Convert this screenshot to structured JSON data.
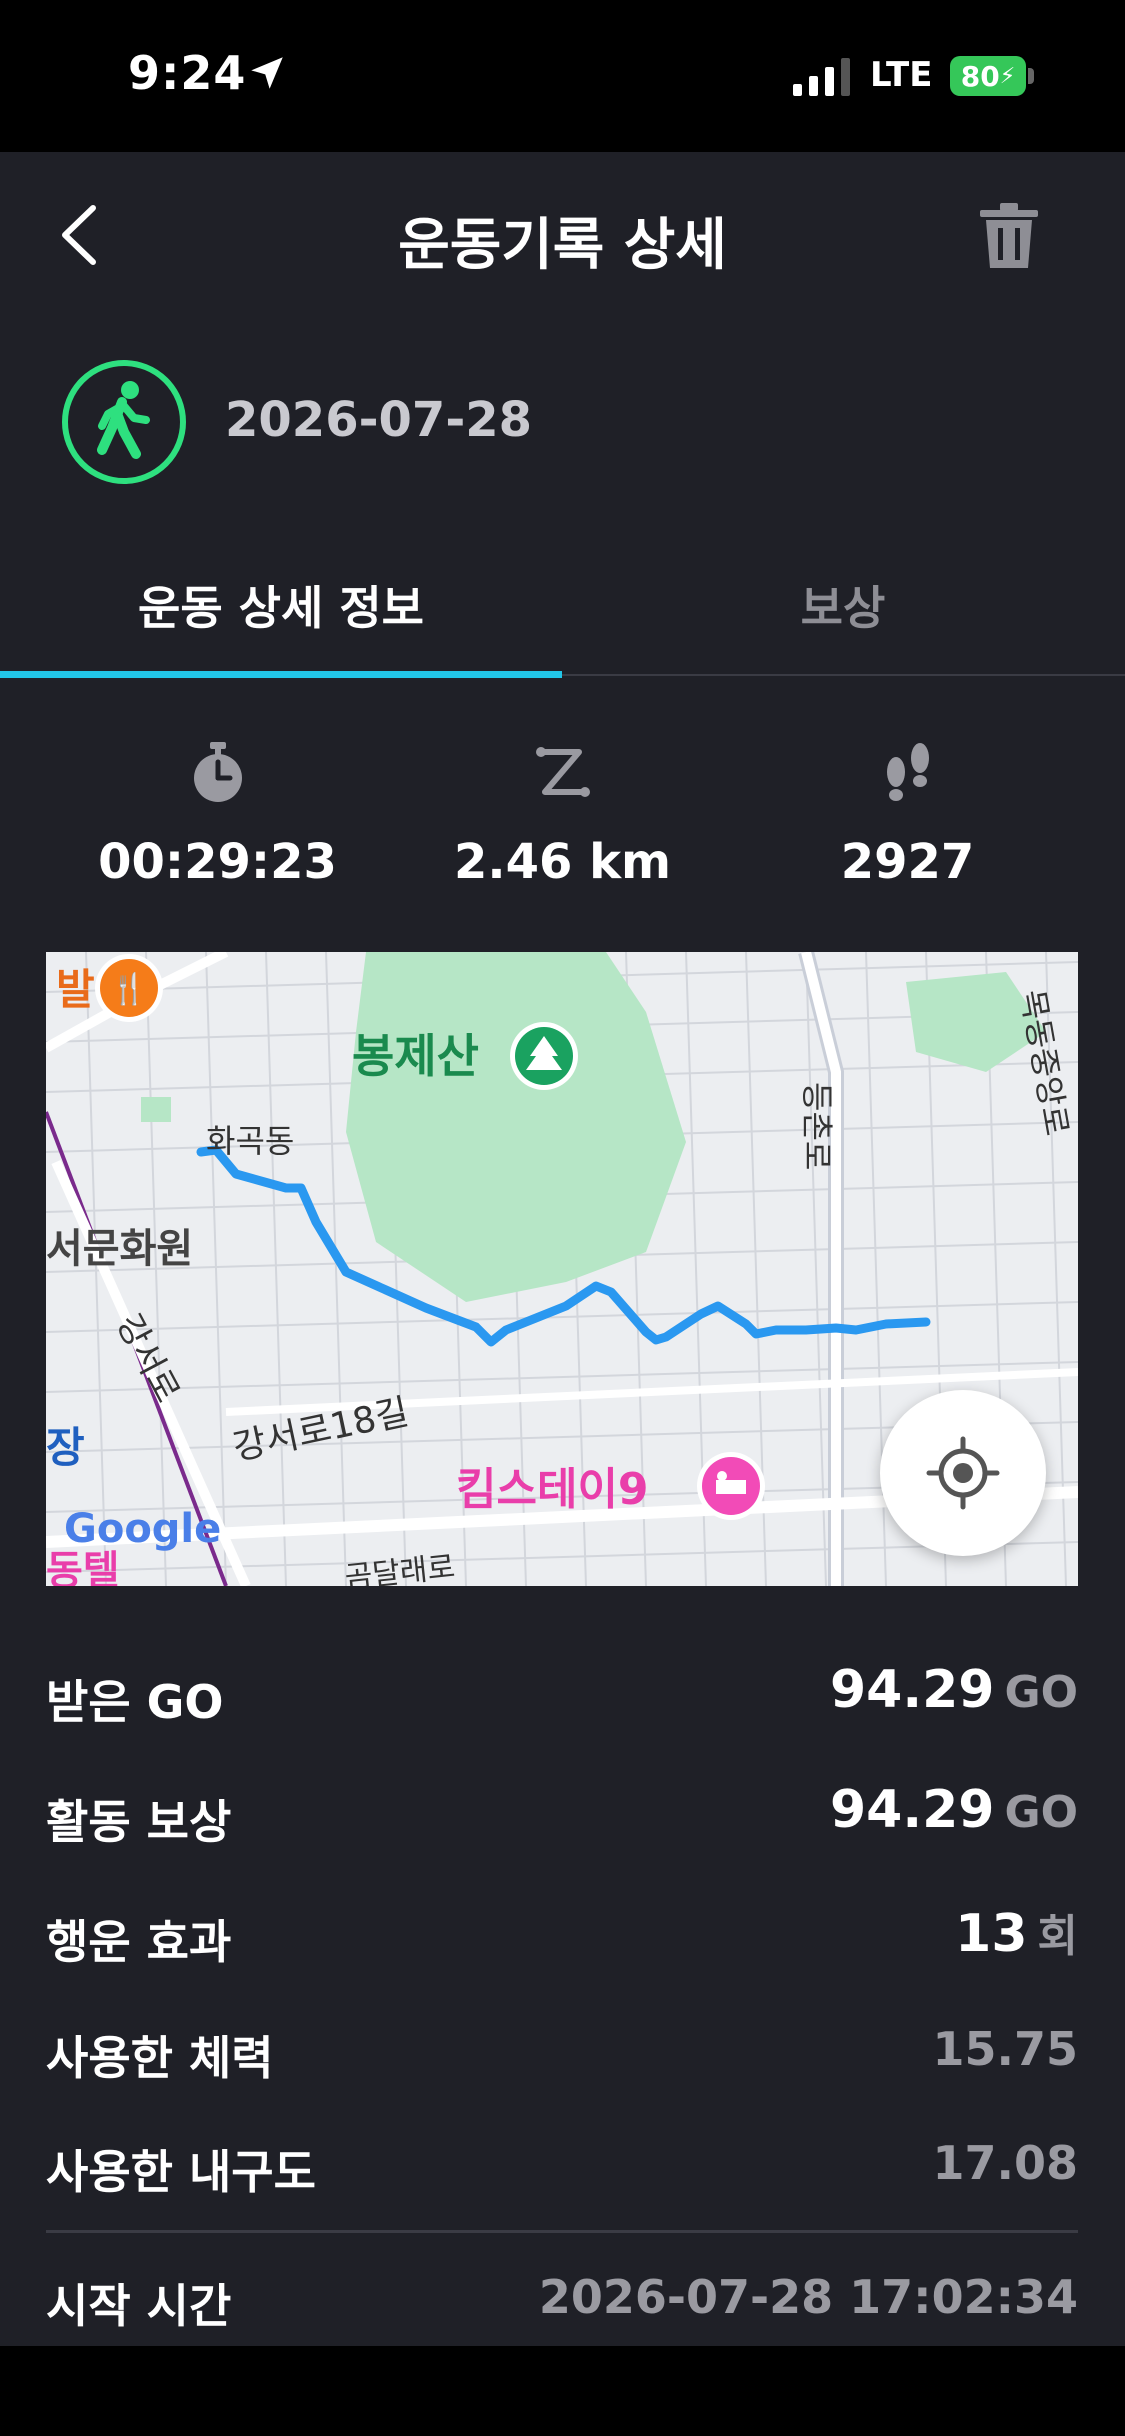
{
  "status_bar": {
    "time": "9:24",
    "network": "LTE",
    "battery": "80"
  },
  "header": {
    "title": "운동기록 상세"
  },
  "record": {
    "date": "2026-07-28"
  },
  "tabs": [
    {
      "label": "운동 상세 정보",
      "active": true
    },
    {
      "label": "보상",
      "active": false
    }
  ],
  "stats": {
    "duration": "00:29:23",
    "distance": "2.46 km",
    "steps": "2927"
  },
  "map": {
    "labels": {
      "mountain": "봉제산",
      "hotel": "킴스테이9",
      "road_18": "강서로18길",
      "road_gangseo": "강서로",
      "district": "화곡동",
      "road_deungchon": "등촌로",
      "road_mokdong": "목동중앙로",
      "culture": "서문화원",
      "left_edge_top": "발",
      "left_edge_mid": "장",
      "left_edge_bottom": "동텔",
      "bottom_road": "곰달래로",
      "google": "Google"
    },
    "colors": {
      "route": "#2a98f0",
      "park": "#b6e6c6",
      "poi_food": "#f57c19",
      "poi_hotel": "#f24bb7",
      "poi_park": "#1aa260"
    }
  },
  "rows": [
    {
      "label": "받은 GO",
      "value": "94.29",
      "unit": "GO"
    },
    {
      "label": "활동 보상",
      "value": "94.29",
      "unit": "GO"
    },
    {
      "label": "행운 효과",
      "value": "13",
      "unit": "회"
    },
    {
      "label": "사용한 체력",
      "value": "15.75"
    },
    {
      "label": "사용한 내구도",
      "value": "17.08"
    }
  ],
  "start_time": {
    "label": "시작 시간",
    "value": "2026-07-28 17:02:34"
  },
  "colors": {
    "accent": "#22c6e8",
    "walk_green": "#2ee07f",
    "background": "#1f2027"
  }
}
